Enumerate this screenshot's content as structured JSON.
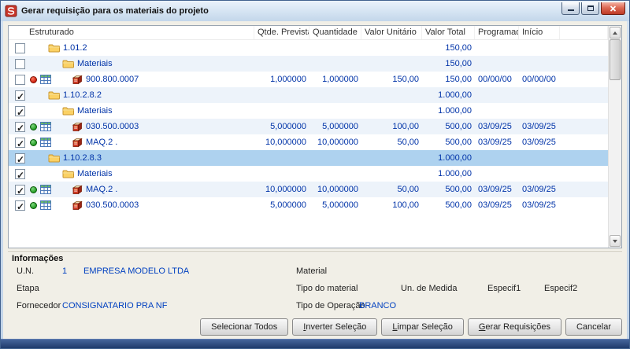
{
  "window": {
    "title": "Gerar requisição para os materiais do projeto"
  },
  "table": {
    "columns": [
      {
        "key": "estruturado",
        "label": "Estruturado"
      },
      {
        "key": "qtde_prevista",
        "label": "Qtde. Prevista"
      },
      {
        "key": "quantidade",
        "label": "Quantidade"
      },
      {
        "key": "valor_unitario",
        "label": "Valor Unitário"
      },
      {
        "key": "valor_total",
        "label": "Valor Total"
      },
      {
        "key": "programada",
        "label": "Programada"
      },
      {
        "key": "inicio",
        "label": "Início"
      }
    ],
    "rows": [
      {
        "checked": false,
        "selected": false,
        "dot": "",
        "grid_icon": false,
        "level": 1,
        "icon": "folder",
        "label": "1.01.2",
        "qtde_prevista": "",
        "quantidade": "",
        "valor_unitario": "",
        "valor_total": "150,00",
        "programada": "",
        "inicio": ""
      },
      {
        "checked": false,
        "selected": false,
        "dot": "",
        "grid_icon": false,
        "level": 2,
        "icon": "folder",
        "label": "Materiais",
        "qtde_prevista": "",
        "quantidade": "",
        "valor_unitario": "",
        "valor_total": "150,00",
        "programada": "",
        "inicio": ""
      },
      {
        "checked": false,
        "selected": false,
        "dot": "red",
        "grid_icon": true,
        "level": 3,
        "icon": "material",
        "label": "900.800.0007",
        "qtde_prevista": "1,000000",
        "quantidade": "1,000000",
        "valor_unitario": "150,00",
        "valor_total": "150,00",
        "programada": "00/00/00",
        "inicio": "00/00/00"
      },
      {
        "checked": true,
        "selected": false,
        "dot": "",
        "grid_icon": false,
        "level": 1,
        "icon": "folder",
        "label": "1.10.2.8.2",
        "qtde_prevista": "",
        "quantidade": "",
        "valor_unitario": "",
        "valor_total": "1.000,00",
        "programada": "",
        "inicio": ""
      },
      {
        "checked": true,
        "selected": false,
        "dot": "",
        "grid_icon": false,
        "level": 2,
        "icon": "folder",
        "label": "Materiais",
        "qtde_prevista": "",
        "quantidade": "",
        "valor_unitario": "",
        "valor_total": "1.000,00",
        "programada": "",
        "inicio": ""
      },
      {
        "checked": true,
        "selected": false,
        "dot": "green",
        "grid_icon": true,
        "level": 3,
        "icon": "material",
        "label": "030.500.0003",
        "qtde_prevista": "5,000000",
        "quantidade": "5,000000",
        "valor_unitario": "100,00",
        "valor_total": "500,00",
        "programada": "03/09/25",
        "inicio": "03/09/25"
      },
      {
        "checked": true,
        "selected": false,
        "dot": "green",
        "grid_icon": true,
        "level": 3,
        "icon": "material",
        "label": "MAQ.2 .",
        "qtde_prevista": "10,000000",
        "quantidade": "10,000000",
        "valor_unitario": "50,00",
        "valor_total": "500,00",
        "programada": "03/09/25",
        "inicio": "03/09/25"
      },
      {
        "checked": true,
        "selected": true,
        "dot": "",
        "grid_icon": false,
        "level": 1,
        "icon": "folder",
        "label": "1.10.2.8.3",
        "qtde_prevista": "",
        "quantidade": "",
        "valor_unitario": "",
        "valor_total": "1.000,00",
        "programada": "",
        "inicio": ""
      },
      {
        "checked": true,
        "selected": false,
        "dot": "",
        "grid_icon": false,
        "level": 2,
        "icon": "folder",
        "label": "Materiais",
        "qtde_prevista": "",
        "quantidade": "",
        "valor_unitario": "",
        "valor_total": "1.000,00",
        "programada": "",
        "inicio": ""
      },
      {
        "checked": true,
        "selected": false,
        "dot": "green",
        "grid_icon": true,
        "level": 3,
        "icon": "material",
        "label": "MAQ.2 .",
        "qtde_prevista": "10,000000",
        "quantidade": "10,000000",
        "valor_unitario": "50,00",
        "valor_total": "500,00",
        "programada": "03/09/25",
        "inicio": "03/09/25"
      },
      {
        "checked": true,
        "selected": false,
        "dot": "green",
        "grid_icon": true,
        "level": 3,
        "icon": "material",
        "label": "030.500.0003",
        "qtde_prevista": "5,000000",
        "quantidade": "5,000000",
        "valor_unitario": "100,00",
        "valor_total": "500,00",
        "programada": "03/09/25",
        "inicio": "03/09/25"
      }
    ]
  },
  "info": {
    "title": "Informações",
    "un_label": "U.N.",
    "un_value": "1",
    "un_name": "EMPRESA MODELO LTDA",
    "etapa_label": "Etapa",
    "fornecedor_label": "Fornecedor",
    "fornecedor_value": "CONSIGNATARIO PRA NF",
    "material_label": "Material",
    "tipo_material_label": "Tipo do material",
    "un_medida_label": "Un. de Medida",
    "especif1_label": "Especif1",
    "especif2_label": "Especif2",
    "tipo_operacao_label": "Tipo de Operação",
    "tipo_operacao_value": "BRANCO"
  },
  "buttons": [
    {
      "id": "selecionar-todos",
      "label": "Selecionar Todos",
      "mnemonic": -1
    },
    {
      "id": "inverter-selecao",
      "label": "Inverter Seleção",
      "mnemonic": 0
    },
    {
      "id": "limpar-selecao",
      "label": "Limpar Seleção",
      "mnemonic": 0
    },
    {
      "id": "gerar-requisicoes",
      "label": "Gerar Requisições",
      "mnemonic": 0
    },
    {
      "id": "cancelar",
      "label": "Cancelar",
      "mnemonic": -1
    }
  ],
  "colors": {
    "grid_text_blue": "#0033a8",
    "selected_row": "#aed2ef",
    "alt_row": "#edf3fa",
    "status_red": "#c81808",
    "status_green": "#1f9a1f",
    "close_button_red": "#bd3a26"
  }
}
